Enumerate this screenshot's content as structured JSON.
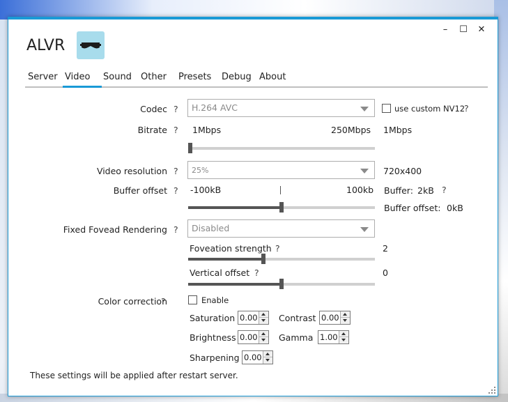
{
  "window": {
    "app_title": "ALVR",
    "controls": {
      "minimize": "–",
      "maximize": "☐",
      "close": "✕"
    }
  },
  "tabs": [
    "Server",
    "Video",
    "Sound",
    "Other",
    "Presets",
    "Debug",
    "About"
  ],
  "active_tab": "Video",
  "help_mark": "?",
  "codec": {
    "label": "Codec",
    "value": "H.264 AVC",
    "custom_nv12_label": "use custom NV12",
    "custom_nv12_checked": false
  },
  "bitrate": {
    "label": "Bitrate",
    "min_label": "1Mbps",
    "max_label": "250Mbps",
    "value_label": "1Mbps",
    "fraction": 0.0
  },
  "video_resolution": {
    "label": "Video resolution",
    "value": "25%",
    "readout": "720x400"
  },
  "buffer_offset": {
    "label": "Buffer offset",
    "min_label": "-100kB",
    "max_label": "100kb",
    "fraction": 0.5,
    "buffer_label": "Buffer:",
    "buffer_value": "2kB",
    "offset_label": "Buffer offset:",
    "offset_value": "0kB"
  },
  "ffr": {
    "label": "Fixed Fovead Rendering",
    "value": "Disabled",
    "strength_label": "Foveation strength",
    "strength_value": "2",
    "strength_fraction": 0.4,
    "vertical_label": "Vertical offset",
    "vertical_value": "0",
    "vertical_fraction": 0.5
  },
  "color_correction": {
    "label": "Color correction",
    "enable_label": "Enable",
    "enabled": false,
    "saturation_label": "Saturation",
    "saturation": "0.00",
    "contrast_label": "Contrast",
    "contrast": "0.00",
    "brightness_label": "Brightness",
    "brightness": "0.00",
    "gamma_label": "Gamma",
    "gamma": "1.00",
    "sharpening_label": "Sharpening",
    "sharpening": "0.00"
  },
  "footer_note": "These settings will be applied after restart server.",
  "colors": {
    "accent": "#1a9ad6",
    "logo_bg": "#a8dcec"
  }
}
